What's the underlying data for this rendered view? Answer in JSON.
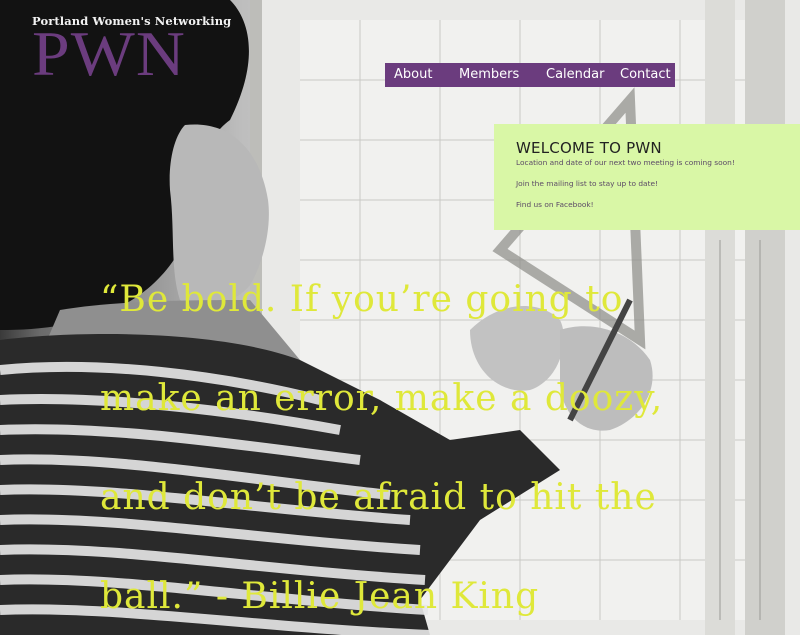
{
  "logo": {
    "tagline": "Portland Women's Networking",
    "mark": "PWN"
  },
  "nav": {
    "items": [
      "About",
      "Members",
      "Calendar",
      "Contact"
    ]
  },
  "welcome": {
    "title": "WELCOME TO PWN",
    "line1": "Location and date of our next two meeting is coming soon!",
    "line2": "Join the mailing list to stay up to date!",
    "line3": "Find us on Facebook!"
  },
  "quote": {
    "lines": [
      "“Be bold. If you’re going to",
      "make an error, make a doozy,",
      "and don’t be afraid to hit the",
      "ball.” - Billie Jean King"
    ]
  },
  "colors": {
    "brand_purple": "#6b3c7e",
    "welcome_bg": "#d9f7a6",
    "quote_yellow": "#dfe83a"
  },
  "icons": {
    "background": "photo-woman-drafting"
  }
}
